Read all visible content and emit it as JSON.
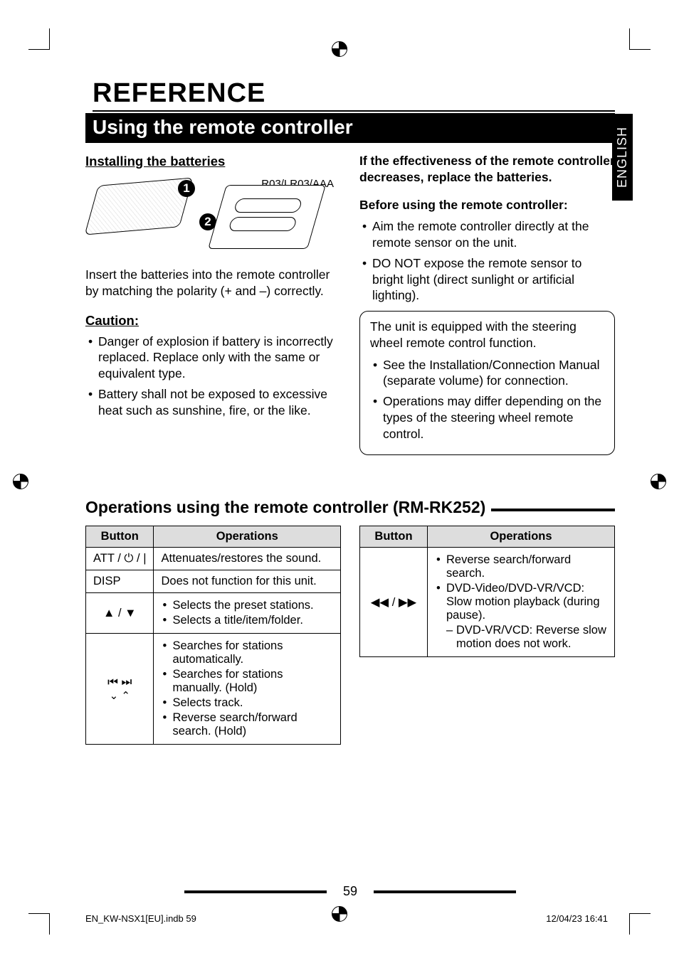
{
  "lang_tab": "ENGLISH",
  "title": "REFERENCE",
  "section": "Using the remote controller",
  "left": {
    "h_install": "Installing the batteries",
    "battery_type": "R03/LR03/AAA",
    "callout1": "1",
    "callout2": "2",
    "insert_text": "Insert the batteries into the remote controller by matching the polarity (+ and –) correctly.",
    "h_caution": "Caution:",
    "caution_items": [
      "Danger of explosion if battery is incorrectly replaced. Replace only with the same or equivalent type.",
      "Battery shall not be exposed to excessive heat such as sunshine, fire, or the like."
    ]
  },
  "right": {
    "effectiveness": "If the effectiveness of the remote controller decreases, replace the batteries.",
    "before_h": "Before using the remote controller:",
    "before_items": [
      "Aim the remote controller directly at the remote sensor on the unit.",
      "DO NOT expose the remote sensor to bright light (direct sunlight or artificial lighting)."
    ],
    "box_intro": "The unit is equipped with the steering wheel remote control function.",
    "box_items": [
      "See the Installation/Connection Manual (separate volume) for connection.",
      "Operations may differ depending on the types of the steering wheel remote control."
    ]
  },
  "ops_heading": "Operations using the remote controller (RM-RK252)",
  "table": {
    "h_button": "Button",
    "h_ops": "Operations",
    "left_rows": [
      {
        "btn": "ATT / ⏻ / |",
        "ops_text": "Attenuates/restores the sound."
      },
      {
        "btn": "DISP",
        "ops_text": "Does not function for this unit."
      },
      {
        "btn": "▲ / ▼",
        "ops_list": [
          "Selects the preset stations.",
          "Selects a title/item/folder."
        ]
      },
      {
        "btn": "SKIP",
        "ops_list": [
          "Searches for stations automatically.",
          "Searches for stations manually. (Hold)",
          "Selects track.",
          "Reverse search/forward search. (Hold)"
        ]
      }
    ],
    "right_rows": [
      {
        "btn": "◀◀ / ▶▶",
        "ops_list": [
          "Reverse search/forward search.",
          "DVD-Video/DVD-VR/VCD: Slow motion playback (during pause)."
        ],
        "ops_sub": "DVD-VR/VCD: Reverse slow motion does not work."
      }
    ]
  },
  "page_number": "59",
  "footer_left": "EN_KW-NSX1[EU].indb   59",
  "footer_right": "12/04/23   16:41"
}
